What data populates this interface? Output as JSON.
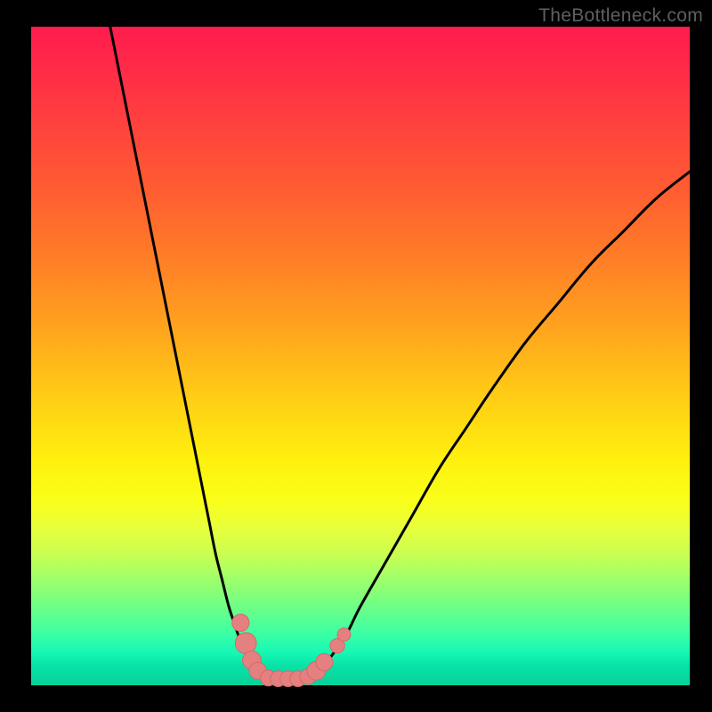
{
  "watermark": "TheBottleneck.com",
  "colors": {
    "background": "#000000",
    "curve_stroke": "#000000",
    "marker_fill": "#e58080",
    "marker_stroke": "#d46a6a"
  },
  "chart_data": {
    "type": "line",
    "title": "",
    "xlabel": "",
    "ylabel": "",
    "xlim": [
      0,
      100
    ],
    "ylim": [
      0,
      100
    ],
    "series": [
      {
        "name": "left-curve",
        "x": [
          12,
          14,
          16,
          18,
          20,
          22,
          24,
          26,
          27,
          28,
          29,
          30,
          31,
          32,
          33,
          34,
          35,
          36
        ],
        "values": [
          100,
          90,
          80,
          70,
          60,
          50,
          40,
          30,
          25,
          20,
          16,
          12,
          9,
          6,
          4,
          2.5,
          1.5,
          1
        ]
      },
      {
        "name": "right-curve",
        "x": [
          42,
          44,
          46,
          48,
          50,
          54,
          58,
          62,
          66,
          70,
          75,
          80,
          85,
          90,
          95,
          100
        ],
        "values": [
          1,
          2.5,
          5,
          8,
          12,
          19,
          26,
          33,
          39,
          45,
          52,
          58,
          64,
          69,
          74,
          78
        ]
      }
    ],
    "markers": [
      {
        "name": "left-cluster-top",
        "x": 31.8,
        "y": 9.5,
        "r": 1.3
      },
      {
        "name": "left-cluster-upper",
        "x": 32.6,
        "y": 6.4,
        "r": 1.6
      },
      {
        "name": "left-cluster-mid",
        "x": 33.5,
        "y": 3.8,
        "r": 1.4
      },
      {
        "name": "left-cluster-low",
        "x": 34.4,
        "y": 2.2,
        "r": 1.3
      },
      {
        "name": "bottom-dot-1",
        "x": 36.0,
        "y": 1.1,
        "r": 1.2
      },
      {
        "name": "bottom-dot-2",
        "x": 37.5,
        "y": 1.0,
        "r": 1.2
      },
      {
        "name": "bottom-dot-3",
        "x": 39.0,
        "y": 1.0,
        "r": 1.2
      },
      {
        "name": "bottom-dot-4",
        "x": 40.5,
        "y": 1.0,
        "r": 1.2
      },
      {
        "name": "bottom-dot-5",
        "x": 42.0,
        "y": 1.3,
        "r": 1.2
      },
      {
        "name": "right-cluster-low",
        "x": 43.3,
        "y": 2.2,
        "r": 1.4
      },
      {
        "name": "right-cluster-mid",
        "x": 44.5,
        "y": 3.5,
        "r": 1.3
      },
      {
        "name": "right-cluster-upper",
        "x": 46.5,
        "y": 6.0,
        "r": 1.1
      },
      {
        "name": "right-cluster-top",
        "x": 47.5,
        "y": 7.7,
        "r": 1.0
      }
    ]
  }
}
